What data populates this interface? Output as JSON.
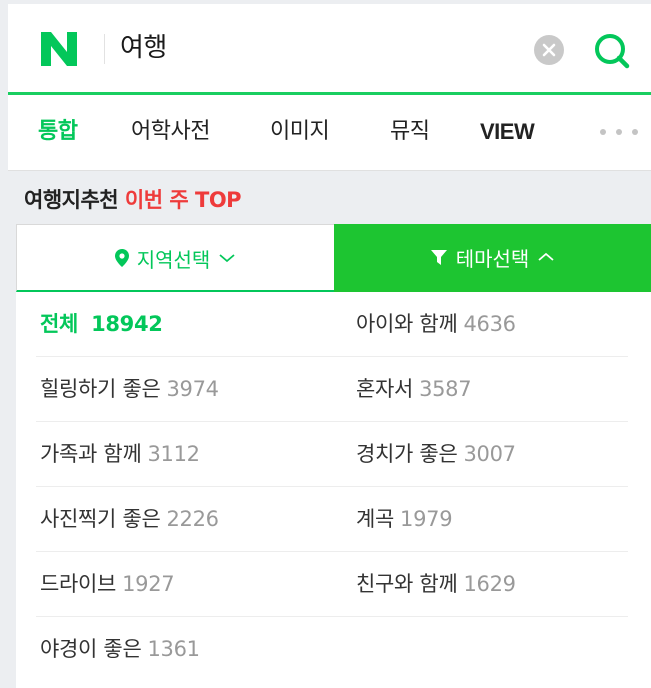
{
  "colors": {
    "brand_green": "#03c75a",
    "theme_button_bg": "#1dc531",
    "highlight_red": "#ee3b3b",
    "count_gray": "#999999"
  },
  "header": {
    "logo_icon": "naver-n-logo",
    "query": "여행",
    "clear_icon": "clear-circle-icon",
    "search_icon": "search-icon"
  },
  "tabs": [
    {
      "label": "통합",
      "active": true
    },
    {
      "label": "어학사전",
      "active": false
    },
    {
      "label": "이미지",
      "active": false
    },
    {
      "label": "뮤직",
      "active": false
    },
    {
      "label": "VIEW",
      "active": false
    }
  ],
  "more_icon": "more-dots-icon",
  "section": {
    "title": "여행지추천",
    "highlight": "이번 주 TOP"
  },
  "selectors": {
    "region": {
      "label": "지역선택",
      "icon": "location-pin-icon",
      "chevron": "chevron-down-icon"
    },
    "theme": {
      "label": "테마선택",
      "icon": "filter-icon",
      "chevron": "chevron-up-icon"
    }
  },
  "themes": [
    [
      {
        "label": "전체",
        "count": "18942",
        "active": true
      },
      {
        "label": "아이와 함께",
        "count": "4636"
      }
    ],
    [
      {
        "label": "힐링하기 좋은",
        "count": "3974"
      },
      {
        "label": "혼자서",
        "count": "3587"
      }
    ],
    [
      {
        "label": "가족과 함께",
        "count": "3112"
      },
      {
        "label": "경치가 좋은",
        "count": "3007"
      }
    ],
    [
      {
        "label": "사진찍기 좋은",
        "count": "2226"
      },
      {
        "label": "계곡",
        "count": "1979"
      }
    ],
    [
      {
        "label": "드라이브",
        "count": "1927"
      },
      {
        "label": "친구와 함께",
        "count": "1629"
      }
    ],
    [
      {
        "label": "야경이 좋은",
        "count": "1361"
      }
    ]
  ]
}
